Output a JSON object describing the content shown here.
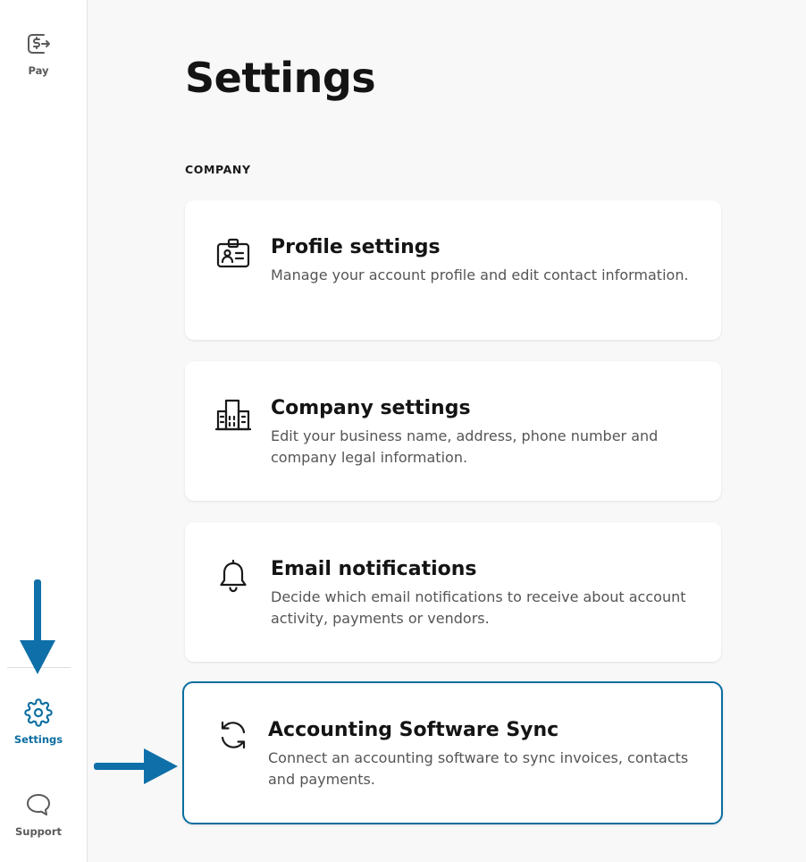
{
  "sidebar": {
    "pay_label": "Pay",
    "settings_label": "Settings",
    "support_label": "Support"
  },
  "page": {
    "title": "Settings",
    "section_label": "COMPANY"
  },
  "cards": [
    {
      "title": "Profile settings",
      "description": "Manage your account profile and edit contact information.",
      "icon": "id-badge-icon"
    },
    {
      "title": "Company settings",
      "description": "Edit your business name, address, phone number and company legal information.",
      "icon": "buildings-icon"
    },
    {
      "title": "Email notifications",
      "description": "Decide which email notifications to receive about account activity, payments or vendors.",
      "icon": "bell-icon"
    },
    {
      "title": "Accounting Software Sync",
      "description": "Connect an accounting software to sync invoices, contacts and payments.",
      "icon": "sync-icon"
    }
  ],
  "colors": {
    "accent": "#0b6ea0",
    "annotation_arrow": "#0f6fa8",
    "background": "#f8f8f8",
    "card": "#ffffff"
  }
}
